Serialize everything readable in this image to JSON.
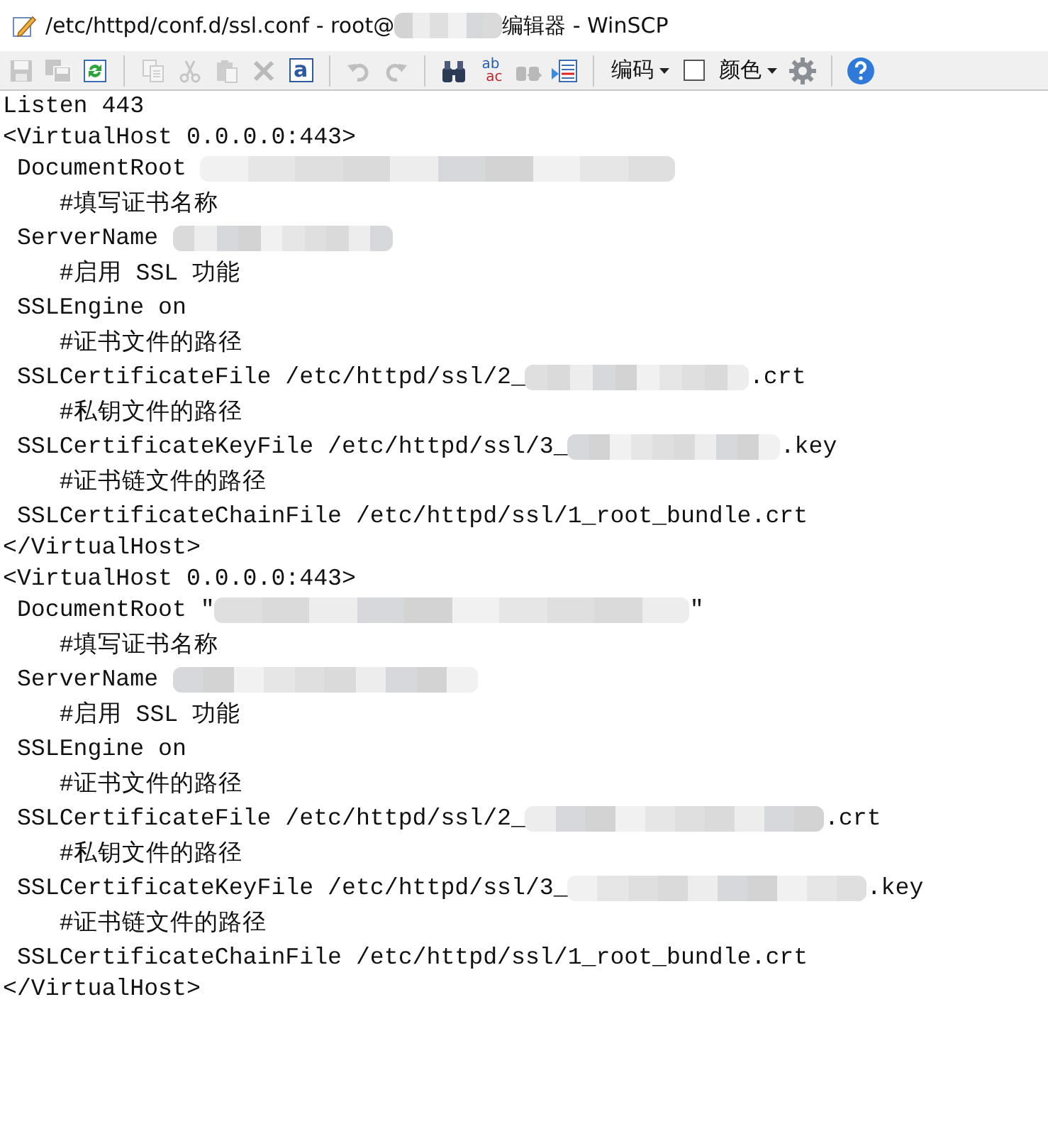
{
  "window": {
    "title": [
      {
        "kind": "text",
        "text": "/etc/httpd/conf.d/ssl.conf - root@"
      },
      {
        "kind": "blur"
      },
      {
        "kind": "text",
        "text": "编辑器 - WinSCP"
      }
    ]
  },
  "toolbar": [
    {
      "kind": "save",
      "disabled": true
    },
    {
      "kind": "save-all",
      "disabled": true
    },
    {
      "kind": "reload",
      "disabled": false
    },
    {
      "kind": "separator"
    },
    {
      "kind": "copy",
      "disabled": true
    },
    {
      "kind": "cut",
      "disabled": true
    },
    {
      "kind": "paste",
      "disabled": true
    },
    {
      "kind": "delete",
      "disabled": true
    },
    {
      "kind": "select-all",
      "disabled": false,
      "label": "a"
    },
    {
      "kind": "separator"
    },
    {
      "kind": "undo",
      "disabled": true
    },
    {
      "kind": "redo",
      "disabled": true
    },
    {
      "kind": "separator"
    },
    {
      "kind": "find",
      "disabled": false
    },
    {
      "kind": "replace",
      "disabled": false,
      "label": "ab",
      "label2": "ac"
    },
    {
      "kind": "find-next",
      "disabled": true
    },
    {
      "kind": "goto-line",
      "disabled": false
    },
    {
      "kind": "separator"
    },
    {
      "kind": "dropdown",
      "label": "编码"
    },
    {
      "kind": "checkbox",
      "checked": false
    },
    {
      "kind": "dropdown",
      "label": "颜色"
    },
    {
      "kind": "settings",
      "disabled": false
    },
    {
      "kind": "separator"
    },
    {
      "kind": "help",
      "disabled": false
    }
  ],
  "lines": [
    [
      {
        "kind": "text",
        "text": "Listen 443"
      }
    ],
    [
      {
        "kind": "text",
        "text": "<VirtualHost 0.0.0.0:443>"
      }
    ],
    [
      {
        "kind": "text",
        "text": " DocumentRoot "
      },
      {
        "kind": "blur"
      }
    ],
    [
      {
        "kind": "text",
        "text": "    #填写证书名称"
      }
    ],
    [
      {
        "kind": "text",
        "text": " ServerName "
      },
      {
        "kind": "blur"
      }
    ],
    [
      {
        "kind": "text",
        "text": "    #启用 SSL 功能"
      }
    ],
    [
      {
        "kind": "text",
        "text": " SSLEngine on"
      }
    ],
    [
      {
        "kind": "text",
        "text": "    #证书文件的路径"
      }
    ],
    [
      {
        "kind": "text",
        "text": " SSLCertificateFile /etc/httpd/ssl/2_"
      },
      {
        "kind": "blur"
      },
      {
        "kind": "text",
        "text": ".crt"
      }
    ],
    [
      {
        "kind": "text",
        "text": "    #私钥文件的路径"
      }
    ],
    [
      {
        "kind": "text",
        "text": " SSLCertificateKeyFile /etc/httpd/ssl/3_"
      },
      {
        "kind": "blur"
      },
      {
        "kind": "text",
        "text": ".key"
      }
    ],
    [
      {
        "kind": "text",
        "text": "    #证书链文件的路径"
      }
    ],
    [
      {
        "kind": "text",
        "text": " SSLCertificateChainFile /etc/httpd/ssl/1_root_bundle.crt"
      }
    ],
    [
      {
        "kind": "text",
        "text": "</VirtualHost>"
      }
    ],
    [
      {
        "kind": "text",
        "text": "<VirtualHost 0.0.0.0:443>"
      }
    ],
    [
      {
        "kind": "text",
        "text": " DocumentRoot \""
      },
      {
        "kind": "blur"
      },
      {
        "kind": "text",
        "text": "\""
      }
    ],
    [
      {
        "kind": "text",
        "text": "    #填写证书名称"
      }
    ],
    [
      {
        "kind": "text",
        "text": " ServerName "
      },
      {
        "kind": "blur"
      }
    ],
    [
      {
        "kind": "text",
        "text": "    #启用 SSL 功能"
      }
    ],
    [
      {
        "kind": "text",
        "text": " SSLEngine on"
      }
    ],
    [
      {
        "kind": "text",
        "text": "    #证书文件的路径"
      }
    ],
    [
      {
        "kind": "text",
        "text": " SSLCertificateFile /etc/httpd/ssl/2_"
      },
      {
        "kind": "blur"
      },
      {
        "kind": "text",
        "text": ".crt"
      }
    ],
    [
      {
        "kind": "text",
        "text": "    #私钥文件的路径"
      }
    ],
    [
      {
        "kind": "text",
        "text": " SSLCertificateKeyFile /etc/httpd/ssl/3_"
      },
      {
        "kind": "blur"
      },
      {
        "kind": "text",
        "text": ".key"
      }
    ],
    [
      {
        "kind": "text",
        "text": "    #证书链文件的路径"
      }
    ],
    [
      {
        "kind": "text",
        "text": " SSLCertificateChainFile /etc/httpd/ssl/1_root_bundle.crt"
      }
    ],
    [
      {
        "kind": "text",
        "text": "</VirtualHost>"
      }
    ]
  ]
}
